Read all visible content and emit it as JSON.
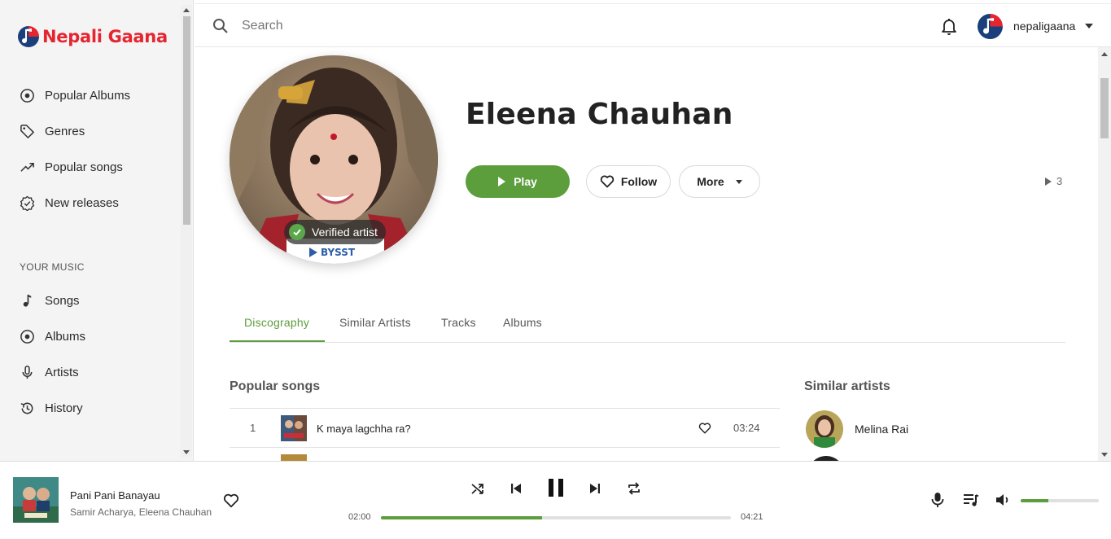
{
  "brand": {
    "name": "Nepali Gaana",
    "color": "#e5252f"
  },
  "accent": "#5c9d3c",
  "sidebar": {
    "items": [
      {
        "label": "Popular Albums",
        "icon": "album-icon"
      },
      {
        "label": "Genres",
        "icon": "tag-icon"
      },
      {
        "label": "Popular songs",
        "icon": "trending-icon"
      },
      {
        "label": "New releases",
        "icon": "new-releases-icon"
      }
    ],
    "section_title": "YOUR MUSIC",
    "music_items": [
      {
        "label": "Songs",
        "icon": "music-note-icon"
      },
      {
        "label": "Albums",
        "icon": "album-icon"
      },
      {
        "label": "Artists",
        "icon": "mic-icon"
      },
      {
        "label": "History",
        "icon": "history-icon"
      }
    ]
  },
  "header": {
    "search_placeholder": "Search",
    "username": "nepaligaana"
  },
  "artist": {
    "name": "Eleena Chauhan",
    "verified_label": "Verified artist",
    "play_label": "Play",
    "follow_label": "Follow",
    "more_label": "More",
    "play_count": "3"
  },
  "tabs": [
    {
      "label": "Discography",
      "active": true
    },
    {
      "label": "Similar Artists",
      "active": false
    },
    {
      "label": "Tracks",
      "active": false
    },
    {
      "label": "Albums",
      "active": false
    }
  ],
  "popular_songs": {
    "title": "Popular songs",
    "rows": [
      {
        "num": "1",
        "title": "K maya lagchha ra?",
        "duration": "03:24"
      }
    ]
  },
  "similar_artists": {
    "title": "Similar artists",
    "rows": [
      {
        "name": "Melina Rai"
      }
    ]
  },
  "player": {
    "title": "Pani Pani Banayau",
    "artist": "Samir Acharya, Eleena Chauhan",
    "current_time": "02:00",
    "total_time": "04:21",
    "progress": 0.46,
    "volume": 0.35
  }
}
